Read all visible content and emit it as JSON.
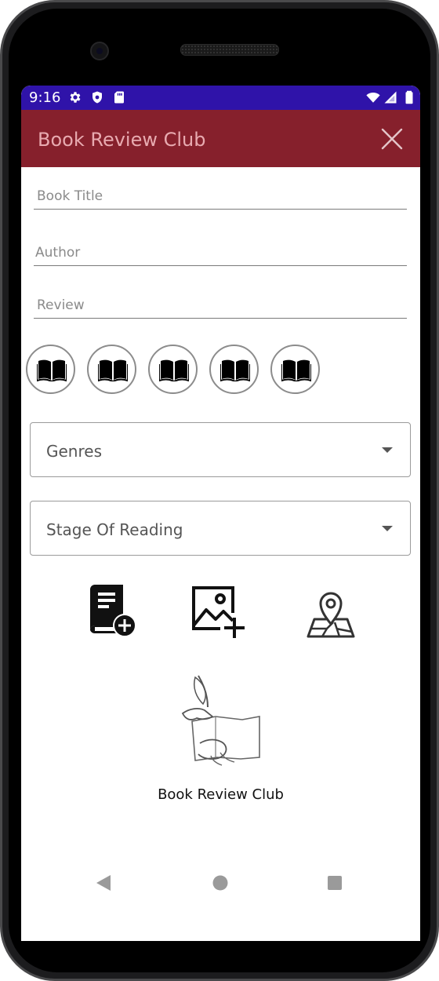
{
  "status_bar": {
    "time": "9:16",
    "left_icons": [
      "gear-icon",
      "shield-icon",
      "sd-card-icon"
    ],
    "right_icons": [
      "wifi-icon",
      "signal-icon",
      "battery-icon"
    ],
    "background": "#2f13a9"
  },
  "app_bar": {
    "title": "Book Review Club",
    "background": "#86202c",
    "title_color": "#e8aab0",
    "close_icon": "close-icon"
  },
  "form": {
    "book_title": {
      "placeholder": "Book Title",
      "value": ""
    },
    "author": {
      "placeholder": "Author",
      "value": ""
    },
    "review": {
      "placeholder": "Review",
      "value": ""
    }
  },
  "rating": {
    "max": 5,
    "selected": 0,
    "icon": "open-book-icon"
  },
  "dropdowns": {
    "genres": {
      "label": "Genres"
    },
    "stage": {
      "label": "Stage Of Reading"
    }
  },
  "actions": [
    {
      "name": "add-book-button",
      "icon": "add-book-icon"
    },
    {
      "name": "add-image-button",
      "icon": "add-image-icon"
    },
    {
      "name": "location-map-button",
      "icon": "map-pin-icon"
    }
  ],
  "branding": {
    "logo_icon": "quill-book-logo",
    "caption": "Book Review Club"
  },
  "nav_bar": {
    "buttons": [
      "back-icon",
      "home-icon",
      "recents-icon"
    ]
  }
}
